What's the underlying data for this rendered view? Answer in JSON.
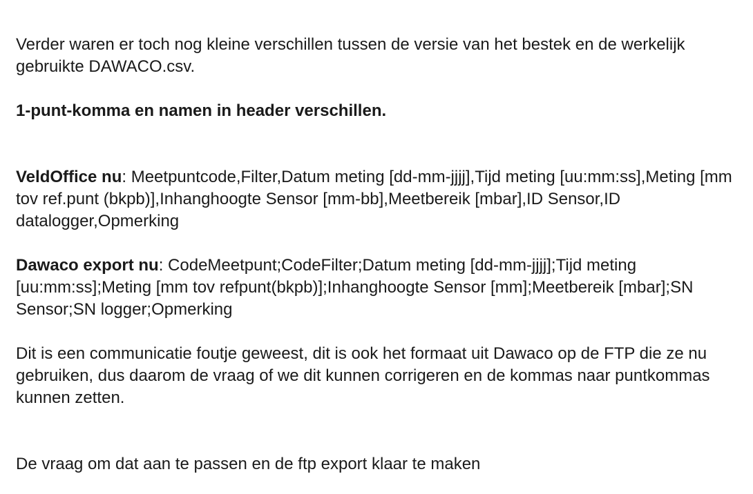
{
  "paragraphs": {
    "intro": "Verder waren er toch nog kleine verschillen tussen de versie van het bestek en de werkelijk gebruikte DAWACO.csv.",
    "heading": "1-punt-komma en namen in header verschillen.",
    "veldoffice": {
      "label": "VeldOffice nu",
      "text": ": Meetpuntcode,Filter,Datum meting [dd-mm-jjjj],Tijd meting [uu:mm:ss],Meting [mm tov ref.punt (bkpb)],Inhanghoogte Sensor [mm-bb],Meetbereik [mbar],ID Sensor,ID datalogger,Opmerking"
    },
    "dawaco": {
      "label": "Dawaco export nu",
      "text": ": CodeMeetpunt;CodeFilter;Datum meting [dd-mm-jjjj];Tijd meting [uu:mm:ss];Meting [mm tov refpunt(bkpb)];Inhanghoogte Sensor [mm];Meetbereik [mbar];SN Sensor;SN logger;Opmerking"
    },
    "explanation": "Dit is een communicatie foutje geweest, dit is ook het formaat uit Dawaco op de FTP die ze nu gebruiken, dus daarom de vraag of we dit kunnen corrigeren en de kommas naar puntkommas kunnen zetten.",
    "closing": "De vraag om dat aan te passen en de ftp export klaar te maken"
  }
}
